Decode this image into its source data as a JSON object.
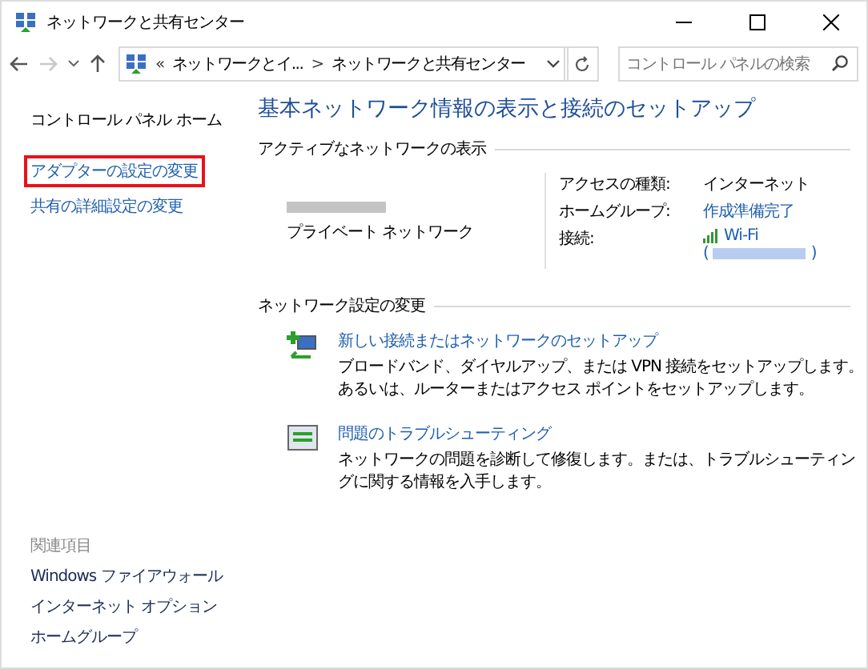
{
  "window": {
    "title": "ネットワークと共有センター"
  },
  "nav": {
    "back": {
      "disabled": false
    },
    "forward": {
      "disabled": true
    }
  },
  "address_bar": {
    "crumbs": [
      {
        "kind": "overflow",
        "text": "«"
      },
      {
        "kind": "link",
        "text": "ネットワークとイ..."
      },
      {
        "kind": "separator",
        "text": ">"
      },
      {
        "kind": "link",
        "text": "ネットワークと共有センター"
      }
    ]
  },
  "search": {
    "placeholder": "コントロール パネルの検索"
  },
  "sidebar": {
    "items": [
      {
        "text": "コントロール パネル ホーム",
        "highlighted": false,
        "kind": "home"
      },
      {
        "text": "アダプターの設定の変更",
        "highlighted": true,
        "kind": "link"
      },
      {
        "text": "共有の詳細設定の変更",
        "highlighted": false,
        "kind": "link"
      }
    ],
    "related_heading": "関連項目",
    "related": [
      "Windows ファイアウォール",
      "インターネット オプション",
      "ホームグループ"
    ]
  },
  "main": {
    "heading": "基本ネットワーク情報の表示と接続のセットアップ",
    "active_section": {
      "title": "アクティブなネットワークの表示",
      "network_type": "プライベート ネットワーク",
      "properties": [
        {
          "kind": "text",
          "label": "アクセスの種類:",
          "value": "インターネット"
        },
        {
          "kind": "link",
          "label": "ホームグループ:",
          "value": "作成準備完了"
        },
        {
          "kind": "wifi",
          "label": "接続:",
          "value": "Wi-Fi",
          "open": "(",
          "close": ")"
        }
      ]
    },
    "change_section": {
      "title": "ネットワーク設定の変更",
      "tasks": [
        {
          "kind": "setup",
          "title": "新しい接続またはネットワークのセットアップ",
          "description": "ブロードバンド、ダイヤルアップ、または VPN 接続をセットアップします。あるいは、ルーターまたはアクセス ポイントをセットアップします。"
        },
        {
          "kind": "troubleshoot",
          "title": "問題のトラブルシューティング",
          "description": "ネットワークの問題を診断して修復します。または、トラブルシューティングに関する情報を入手します。"
        }
      ]
    }
  }
}
